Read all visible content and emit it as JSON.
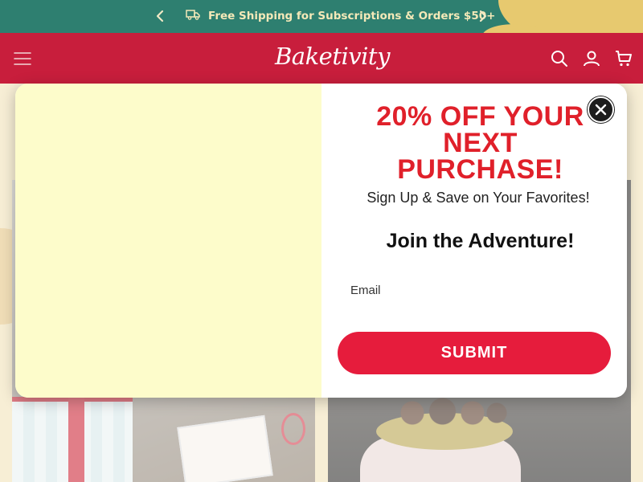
{
  "announcement": {
    "text": "Free Shipping for Subscriptions & Orders $50+",
    "icons": {
      "prev": "chevron-left-icon",
      "next": "chevron-right-icon",
      "shipping": "truck-icon"
    }
  },
  "header": {
    "logo": "Baketivity",
    "icons": {
      "menu": "hamburger-menu-icon",
      "search": "search-icon",
      "account": "user-icon",
      "cart": "cart-icon"
    }
  },
  "popup": {
    "headline_lines": [
      "20% OFF YOUR",
      "NEXT",
      "PURCHASE!"
    ],
    "subheadline": "Sign Up & Save on Your Favorites!",
    "join_text": "Join the Adventure!",
    "email_placeholder": "Email",
    "email_value": "",
    "submit_label": "SUBMIT",
    "close_icon": "close-icon"
  },
  "colors": {
    "announcement_bg": "#2e7f70",
    "announcement_text": "#f4e9b8",
    "header_bg": "#c81e3c",
    "headline": "#e0202a",
    "submit_bg": "#e61c3c",
    "popup_left_panel": "#fdfccb"
  }
}
